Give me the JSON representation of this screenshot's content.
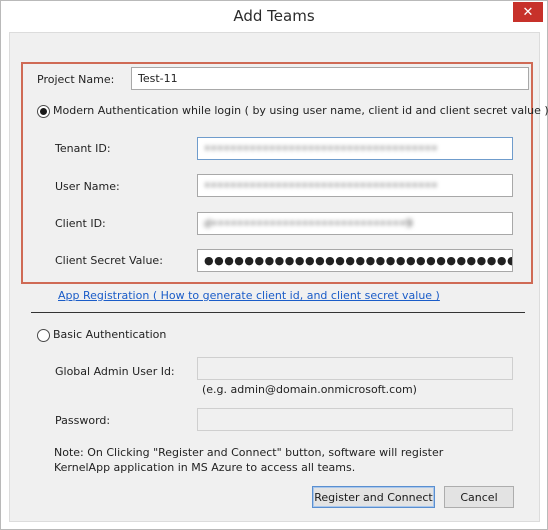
{
  "window": {
    "title": "Add Teams",
    "close_glyph": "✕"
  },
  "project": {
    "label": "Project Name:",
    "value": "Test-11"
  },
  "modern_auth": {
    "radio_label": "Modern Authentication while login ( by using user name, client id and client secret value )",
    "selected": true,
    "tenant_id": {
      "label": "Tenant ID:",
      "value": "••••••••••••••••••••••••••••••••••••"
    },
    "user_name": {
      "label": "User Name:",
      "value": "••••••••••••••••••••••••••••••••••••"
    },
    "client_id": {
      "label": "Client ID:",
      "value": "d••••••••••••••••••••••••••••••9"
    },
    "client_secret": {
      "label": "Client Secret Value:",
      "value": "●●●●●●●●●●●●●●●●●●●●●●●●●●●●●●●●●●●●●●●●"
    }
  },
  "app_registration_link": "App Registration ( How to generate client id, and client secret value )",
  "basic_auth": {
    "radio_label": "Basic Authentication",
    "selected": false,
    "admin_user": {
      "label": "Global Admin User Id:",
      "value": ""
    },
    "admin_hint": "(e.g. admin@domain.onmicrosoft.com)",
    "password": {
      "label": "Password:",
      "value": ""
    }
  },
  "note": "Note: On Clicking \"Register and Connect\" button, software will register KernelApp application in MS Azure to access all teams.",
  "buttons": {
    "register": "Register and Connect",
    "cancel": "Cancel"
  },
  "colors": {
    "group_border": "#cf6a55",
    "link": "#1a5cc8",
    "close_button": "#c7312a"
  }
}
